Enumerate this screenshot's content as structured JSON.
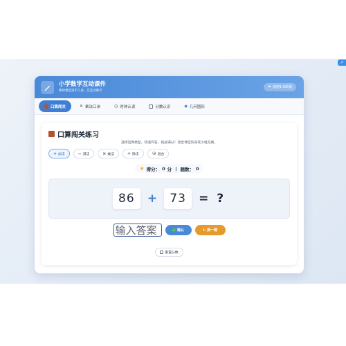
{
  "app": {
    "title": "小学数学互动课件",
    "subtitle": "教师课堂演示工具 · 交互式教学",
    "grade_badge": "适用1-6年级",
    "corner_badge": "↗"
  },
  "tabs": [
    {
      "label": "口算闯关",
      "icon": "abacus-icon",
      "active": true
    },
    {
      "label": "乘法口诀",
      "icon": "times-icon",
      "active": false
    },
    {
      "label": "时钟认读",
      "icon": "clock-icon",
      "active": false
    },
    {
      "label": "分数认识",
      "icon": "fraction-icon",
      "active": false
    },
    {
      "label": "几何图形",
      "icon": "diamond-icon",
      "active": false
    }
  ],
  "practice": {
    "title": "口算闯关练习",
    "description": "选择运算类型，快速作答，挑战满分！适合课堂热身或小组竞赛。",
    "operations": [
      {
        "symbol": "+",
        "label": "加法",
        "active": true
      },
      {
        "symbol": "−",
        "label": "减法",
        "active": false
      },
      {
        "symbol": "×",
        "label": "乘法",
        "active": false
      },
      {
        "symbol": "÷",
        "label": "除法",
        "active": false
      },
      {
        "symbol": "🎲",
        "label": "混合",
        "active": false
      }
    ],
    "score_label": "得分：",
    "score_value": "0",
    "score_unit": "分",
    "separator": "|",
    "count_label": "题数：",
    "count_value": "0",
    "operand_a": "86",
    "operator": "+",
    "operand_b": "73",
    "equals": "= ?",
    "answer_placeholder": "输入答案",
    "confirm_label": "确认",
    "next_label": "换一题",
    "reset_label": "重置分数"
  },
  "colors": {
    "accent": "#3f7fd3",
    "header_start": "#4a89d8",
    "header_end": "#6aa3e6",
    "next_button": "#e59a2b",
    "star": "#f3b818"
  }
}
